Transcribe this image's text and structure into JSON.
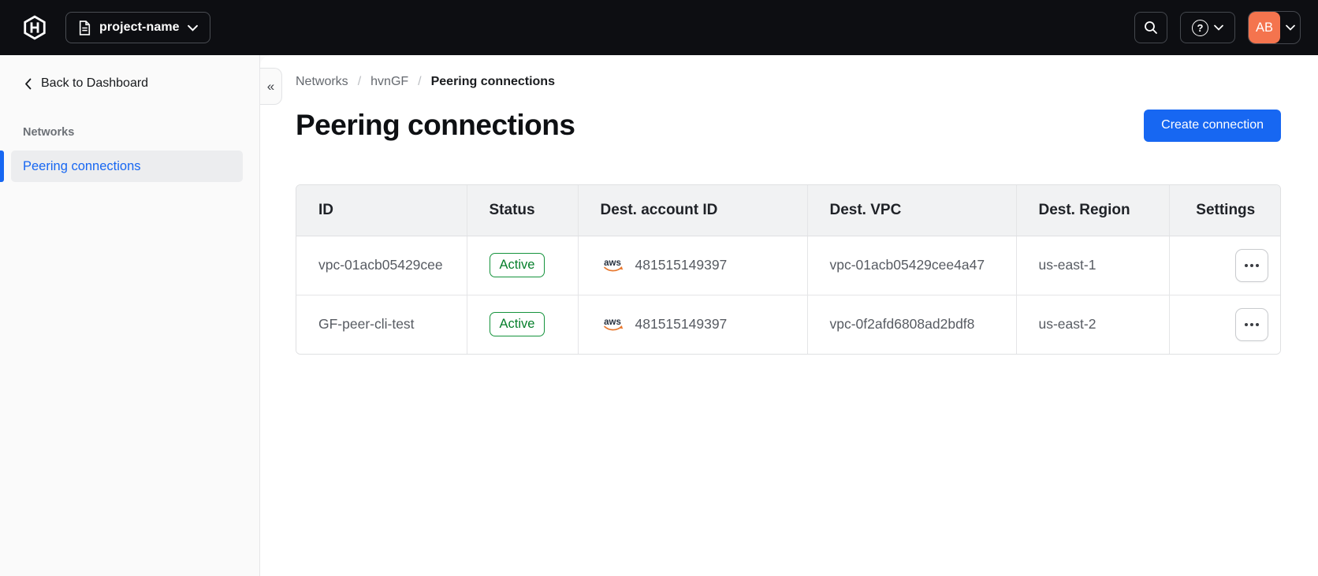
{
  "topbar": {
    "project_label": "project-name",
    "avatar_initials": "AB",
    "help_glyph": "?"
  },
  "sidebar": {
    "back_label": "Back to Dashboard",
    "section_label": "Networks",
    "items": [
      {
        "label": "Peering connections",
        "active": true
      }
    ],
    "collapse_glyph": "«"
  },
  "breadcrumb": {
    "items": [
      "Networks",
      "hvnGF",
      "Peering connections"
    ],
    "separator": "/"
  },
  "page": {
    "title": "Peering connections",
    "create_button_label": "Create connection"
  },
  "table": {
    "columns": [
      "ID",
      "Status",
      "Dest. account ID",
      "Dest. VPC",
      "Dest. Region",
      "Settings"
    ],
    "rows": [
      {
        "id": "vpc-01acb05429cee",
        "status": "Active",
        "dest_account_id": "481515149397",
        "dest_vpc": "vpc-01acb05429cee4a47",
        "dest_region": "us-east-1"
      },
      {
        "id": "GF-peer-cli-test",
        "status": "Active",
        "dest_account_id": "481515149397",
        "dest_vpc": "vpc-0f2afd6808ad2bdf8",
        "dest_region": "us-east-2"
      }
    ]
  },
  "icons": {
    "aws_label": "aws"
  },
  "colors": {
    "topbar_bg": "#0D0E12",
    "accent_blue": "#1767F2",
    "success_green": "#067F2B",
    "avatar_orange": "#F4744E",
    "aws_orange": "#E8772D",
    "sidebar_bg": "#FAFAFA"
  }
}
